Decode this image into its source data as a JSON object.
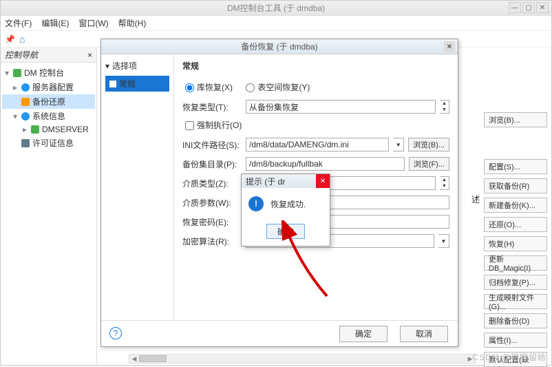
{
  "window": {
    "title": "DM控制台工具 (于 dmdba)",
    "menus": {
      "file": "文件(F)",
      "edit": "编辑(E)",
      "window": "窗口(W)",
      "help": "帮助(H)"
    }
  },
  "nav": {
    "header": "控制导航",
    "root": "DM 控制台",
    "items": {
      "server_cfg": "服务器配置",
      "backup_restore": "备份还原",
      "sys_info": "系统信息",
      "dmserver": "DMSERVER",
      "license": "许可证信息"
    }
  },
  "side_buttons": {
    "browseB": "浏览(B)...",
    "config": "配置(S)...",
    "get_backup": "获取备份(R)",
    "new_backup": "新建备份(K)...",
    "restore": "还原(O)...",
    "recover": "恢复(H)",
    "update_magic": "更新DB_Magic(I)",
    "archive_fix": "归档修复(P)...",
    "gen_map": "生成映射文件(G)...",
    "del_backup": "删除备份(D)",
    "props": "属性(I)...",
    "default_cfg": "默认配置(缺"
  },
  "desc_label": "述",
  "dialog": {
    "title": "备份恢复 (于 dmdba)",
    "left": {
      "header": "选择项",
      "general": "常规"
    },
    "section": "常规",
    "radios": {
      "lib": "库恢复(X)",
      "tbs": "表空间恢复(Y)"
    },
    "labels": {
      "recover_type": "恢复类型(T):",
      "force_exec": "强制执行(O)",
      "ini_path": "INI文件路径(S):",
      "backup_dir": "备份集目录(P):",
      "media_type": "介质类型(Z):",
      "media_param": "介质参数(W):",
      "recover_pwd": "恢复密码(E):",
      "crypto": "加密算法(R):"
    },
    "values": {
      "recover_type": "从备份集恢复",
      "ini_path": "/dm8/data/DAMENG/dm.ini",
      "backup_dir": "/dm8/backup/fullbak",
      "media_type": "",
      "media_param": "",
      "recover_pwd": "",
      "crypto": ""
    },
    "browseB": "浏览(B)...",
    "browseF": "浏览(F)...",
    "footer": {
      "ok": "确定",
      "cancel": "取消"
    }
  },
  "msg": {
    "title": "提示  (于 dr",
    "text": "恢复成功.",
    "ok": "确定"
  },
  "watermark": "CSDN @初吻留给",
  "colors": {
    "accent": "#1976d2",
    "danger": "#e81123"
  }
}
